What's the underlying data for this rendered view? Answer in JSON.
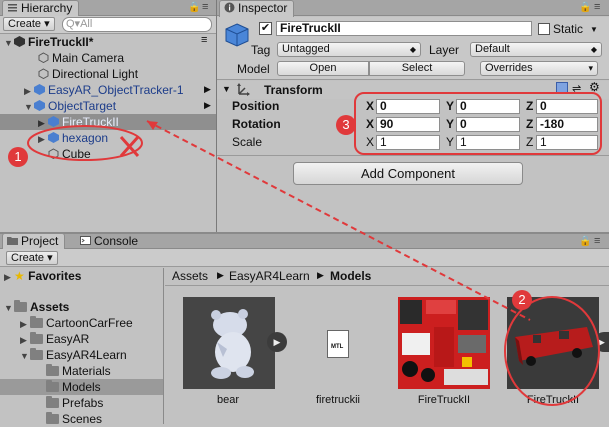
{
  "hierarchy": {
    "tab_label": "Hierarchy",
    "create_label": "Create",
    "search_placeholder": "Q▾All",
    "scene": "FireTruckII*",
    "items": [
      {
        "label": "Main Camera"
      },
      {
        "label": "Directional Light"
      },
      {
        "label": "EasyAR_ObjectTracker-1"
      },
      {
        "label": "ObjectTarget"
      },
      {
        "label": "FireTruckII"
      },
      {
        "label": "hexagon"
      },
      {
        "label": "Cube"
      }
    ]
  },
  "inspector": {
    "tab_label": "Inspector",
    "object_name": "FireTruckII",
    "static_label": "Static",
    "tag_label": "Tag",
    "tag_value": "Untagged",
    "layer_label": "Layer",
    "layer_value": "Default",
    "model_label": "Model",
    "open_label": "Open",
    "select_label": "Select",
    "overrides_label": "Overrides",
    "transform_label": "Transform",
    "rows": [
      {
        "label": "Position",
        "x": "0",
        "y": "0",
        "z": "0"
      },
      {
        "label": "Rotation",
        "x": "90",
        "y": "0",
        "z": "-180"
      },
      {
        "label": "Scale",
        "x": "1",
        "y": "1",
        "z": "1"
      }
    ],
    "axis_x": "X",
    "axis_y": "Y",
    "axis_z": "Z",
    "add_component_label": "Add Component"
  },
  "project": {
    "project_tab": "Project",
    "console_tab": "Console",
    "create_label": "Create",
    "favorites": "Favorites",
    "assets": "Assets",
    "folders": [
      "CartoonCarFree",
      "EasyAR",
      "EasyAR4Learn",
      "Materials",
      "Models",
      "Prefabs",
      "Scenes"
    ],
    "breadcrumb": [
      "Assets",
      "EasyAR4Learn",
      "Models"
    ],
    "files": [
      {
        "name": "bear"
      },
      {
        "name": "firetruckii",
        "icon_text": "MTL"
      },
      {
        "name": "FireTruckII"
      },
      {
        "name": "FireTruckII"
      }
    ]
  },
  "annotations": {
    "marker1": "1",
    "marker2": "2",
    "marker3": "3",
    "accent": "#e0393b"
  }
}
